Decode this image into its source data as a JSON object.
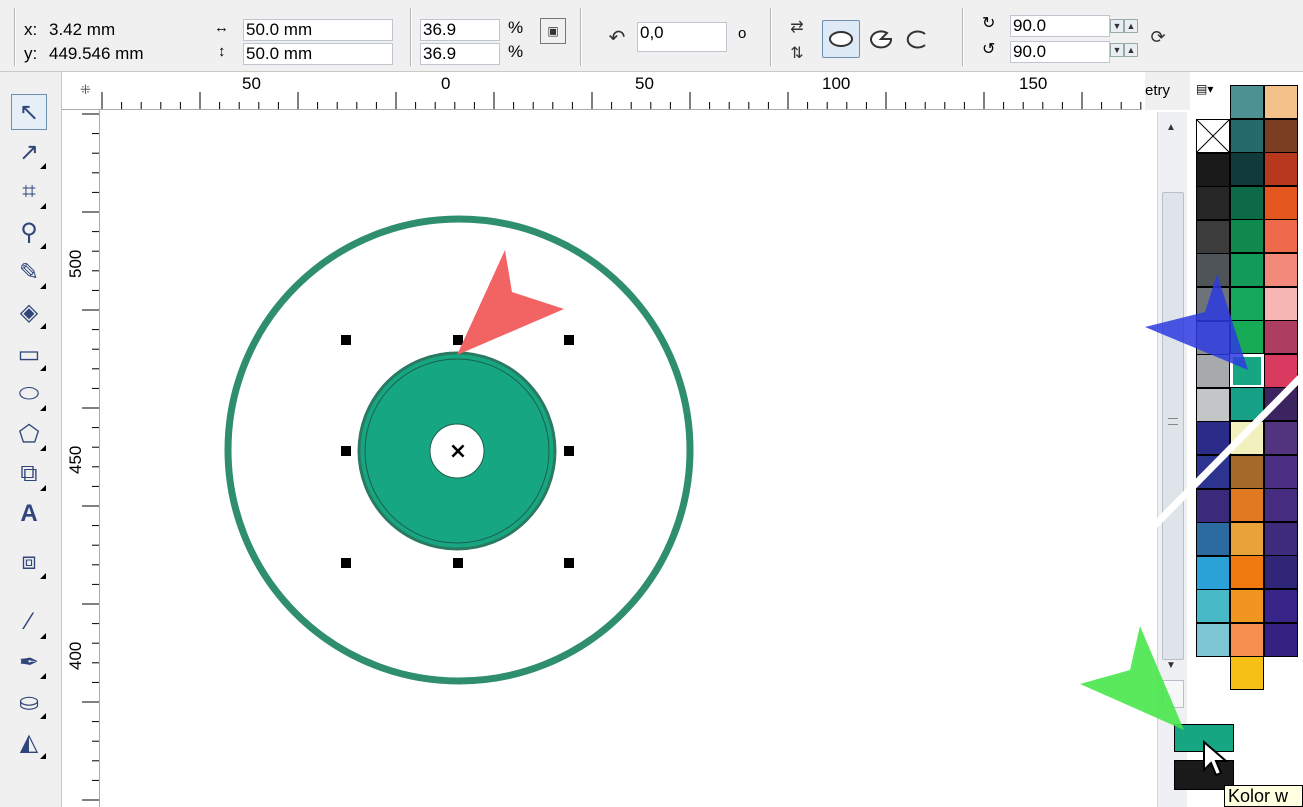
{
  "propbar": {
    "x_label": "x:",
    "x_value": "3.42 mm",
    "y_label": "y:",
    "y_value": "449.546 mm",
    "width_value": "50.0 mm",
    "height_value": "50.0 mm",
    "scale_x": "36.9",
    "scale_y": "36.9",
    "percent_symbol": "%",
    "rotation_value": "0,0",
    "degree_symbol": "o",
    "start_angle": "90.0",
    "end_angle": "90.0"
  },
  "ruler": {
    "h_labels": [
      "50",
      "0",
      "50",
      "100",
      "150"
    ],
    "v_labels": [
      "500",
      "450",
      "400"
    ],
    "docker_label": "etry"
  },
  "toolbox": {
    "tools": [
      "pick-tool",
      "shape-tool",
      "crop-tool",
      "zoom-tool",
      "freehand-tool",
      "smart-fill-tool",
      "rectangle-tool",
      "ellipse-tool",
      "polygon-tool",
      "basic-shapes-tool",
      "text-tool",
      "interactive-blend-tool",
      "eyedropper-tool",
      "outline-tool",
      "fill-tool",
      "interactive-fill-tool"
    ]
  },
  "canvas": {
    "center_marker": "×",
    "outer_ring_color": "#2e8e6e",
    "inner_disc_color": "#17a682"
  },
  "palette": {
    "col1": [
      "none",
      "#1a1a1a",
      "#262626",
      "#3c3c3c",
      "#4f5459",
      "#6d7378",
      "#8b8f92",
      "#a6aaac",
      "#c3c5c7",
      "#2b2c8a",
      "#2d3490",
      "#3b2a7c",
      "#2b6b9f",
      "#2aa2d8",
      "#48b9c7",
      "#7cc6d3"
    ],
    "col2": [
      "#4d9292",
      "#266b6b",
      "#113b3b",
      "#0d6a46",
      "#10894f",
      "#129a5a",
      "#14a85d",
      "#18ab55",
      "#17a682",
      "#16a187",
      "#f2f1be",
      "#a36a2a",
      "#e07a22",
      "#e8a23a",
      "#f07a10",
      "#f09620",
      "#f58e4e",
      "#f6c015"
    ],
    "col3": [
      "#f5c18a",
      "#7c3e23",
      "#b8381d",
      "#e3561e",
      "#ee6a4b",
      "#f3897a",
      "#f6b7b4",
      "#ad3e62",
      "#d93a60",
      "#3c2460",
      "#52347e",
      "#4a2f83",
      "#462d80",
      "#3e2b7b",
      "#2f2678",
      "#37258a",
      "#332282"
    ],
    "fill_color": "#17a682",
    "outline_color": "#1a1a1a"
  },
  "tooltip": {
    "text": "Kolor w"
  }
}
